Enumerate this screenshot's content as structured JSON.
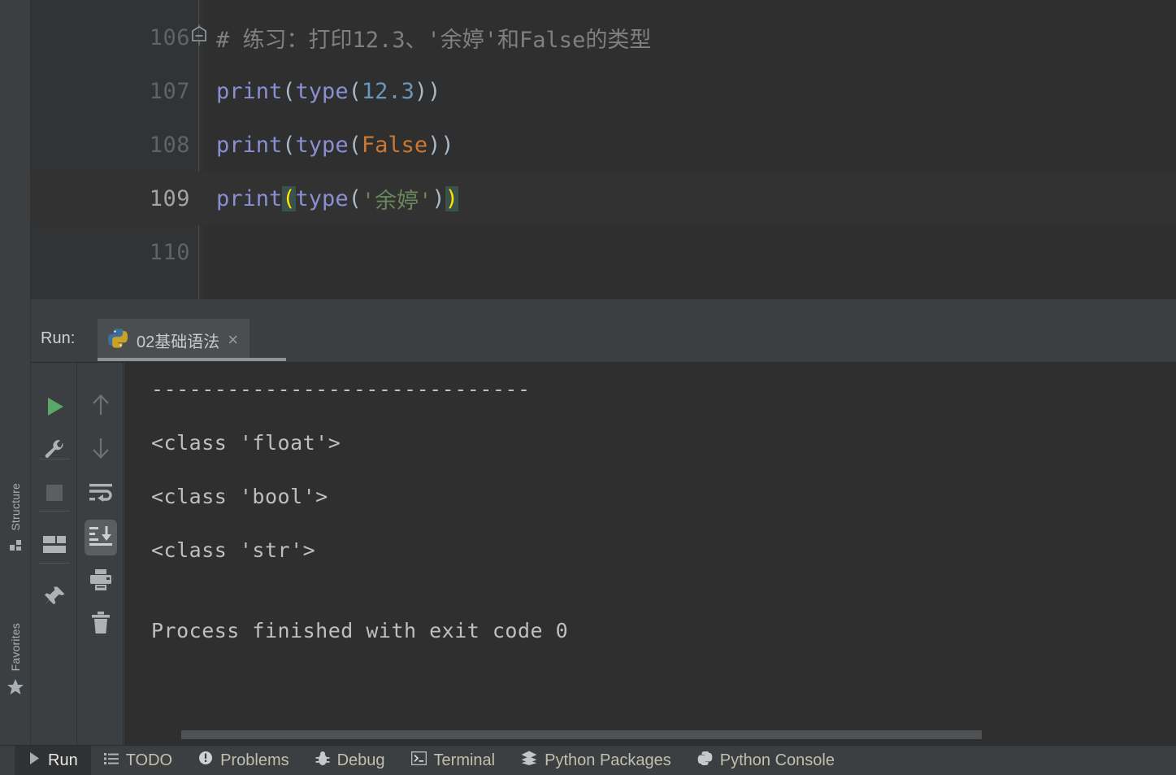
{
  "editor": {
    "lines": [
      {
        "number": "106",
        "kind": "comment",
        "fold": true,
        "text": "# 练习：打印12.3、'余婷'和False的类型"
      },
      {
        "number": "107",
        "kind": "code",
        "text": "print(type(12.3))",
        "parts": [
          {
            "t": "print",
            "c": "fn"
          },
          {
            "t": "(",
            "c": "paren"
          },
          {
            "t": "type",
            "c": "builtin"
          },
          {
            "t": "(",
            "c": "paren"
          },
          {
            "t": "12.3",
            "c": "num"
          },
          {
            "t": "))",
            "c": "paren"
          }
        ]
      },
      {
        "number": "108",
        "kind": "code",
        "text": "print(type(False))",
        "parts": [
          {
            "t": "print",
            "c": "fn"
          },
          {
            "t": "(",
            "c": "paren"
          },
          {
            "t": "type",
            "c": "builtin"
          },
          {
            "t": "(",
            "c": "paren"
          },
          {
            "t": "False",
            "c": "kw"
          },
          {
            "t": "))",
            "c": "paren"
          }
        ]
      },
      {
        "number": "109",
        "kind": "code",
        "caret": true,
        "text": "print(type('余婷'))",
        "parts": [
          {
            "t": "print",
            "c": "fn"
          },
          {
            "t": "(",
            "c": "match"
          },
          {
            "t": "type",
            "c": "builtin"
          },
          {
            "t": "(",
            "c": "paren"
          },
          {
            "t": "'余婷'",
            "c": "str"
          },
          {
            "t": ")",
            "c": "paren"
          },
          {
            "t": ")",
            "c": "match"
          }
        ]
      },
      {
        "number": "110",
        "kind": "code",
        "text": "",
        "parts": []
      }
    ]
  },
  "left_stripe": {
    "buttons": [
      {
        "label": "Structure",
        "icon": "structure-icon"
      },
      {
        "label": "Favorites",
        "icon": "star-icon"
      }
    ]
  },
  "run_window": {
    "title": "Run:",
    "tab": {
      "label": "02基础语法",
      "icon": "python-icon",
      "close": "×"
    },
    "toolbar_left": [
      {
        "name": "rerun-button",
        "icon": "play-icon",
        "color": "#59a869"
      },
      {
        "name": "modify-run-configuration-button",
        "icon": "wrench-icon",
        "color": "#afb1b3"
      },
      {
        "name": "stop-button",
        "icon": "stop-icon",
        "color": "#5c5f61"
      },
      {
        "name": "restore-layout-button",
        "icon": "layout-icon",
        "color": "#afb1b3"
      },
      {
        "name": "pin-tab-button",
        "icon": "pin-icon",
        "color": "#afb1b3"
      }
    ],
    "toolbar_right": [
      {
        "name": "up-the-stack-trace-button",
        "icon": "arrow-up-icon",
        "color": "#6e7174"
      },
      {
        "name": "down-the-stack-trace-button",
        "icon": "arrow-down-icon",
        "color": "#6e7174"
      },
      {
        "name": "soft-wrap-button",
        "icon": "soft-wrap-icon",
        "color": "#afb1b3"
      },
      {
        "name": "scroll-to-end-button",
        "icon": "scroll-to-end-icon",
        "color": "#cdd0d2",
        "active": true
      },
      {
        "name": "print-button",
        "icon": "printer-icon",
        "color": "#afb1b3"
      },
      {
        "name": "clear-all-button",
        "icon": "trash-icon",
        "color": "#afb1b3"
      }
    ],
    "console": {
      "lines": [
        "------------------------------",
        "",
        "<class 'float'>",
        "",
        "<class 'bool'>",
        "",
        "<class 'str'>",
        "",
        "",
        "Process finished with exit code 0"
      ],
      "separator": "------------------------------",
      "float_type": "<class 'float'>",
      "bool_type": "<class 'bool'>",
      "str_type": "<class 'str'>",
      "exit_message": "Process finished with exit code 0"
    }
  },
  "statusbar": {
    "items": [
      {
        "label": "Run",
        "icon": "play-icon",
        "active": true
      },
      {
        "label": "TODO",
        "icon": "todo-list-icon",
        "active": false
      },
      {
        "label": "Problems",
        "icon": "problems-icon",
        "active": false
      },
      {
        "label": "Debug",
        "icon": "bug-icon",
        "active": false
      },
      {
        "label": "Terminal",
        "icon": "terminal-icon",
        "active": false
      },
      {
        "label": "Python Packages",
        "icon": "packages-icon",
        "active": false
      },
      {
        "label": "Python Console",
        "icon": "python-icon",
        "active": false
      }
    ]
  },
  "colors": {
    "editor_bg": "#2f2f2f",
    "gutter_bg": "#313335",
    "panel_bg": "#3c3f41",
    "console_bg": "#2f2f2f",
    "accent_green": "#59a869",
    "string_green": "#6a8759",
    "keyword_orange": "#cc7832",
    "number_blue": "#6897bb",
    "function_violet": "#8a8fd4",
    "match_yellow": "#ffe400"
  }
}
